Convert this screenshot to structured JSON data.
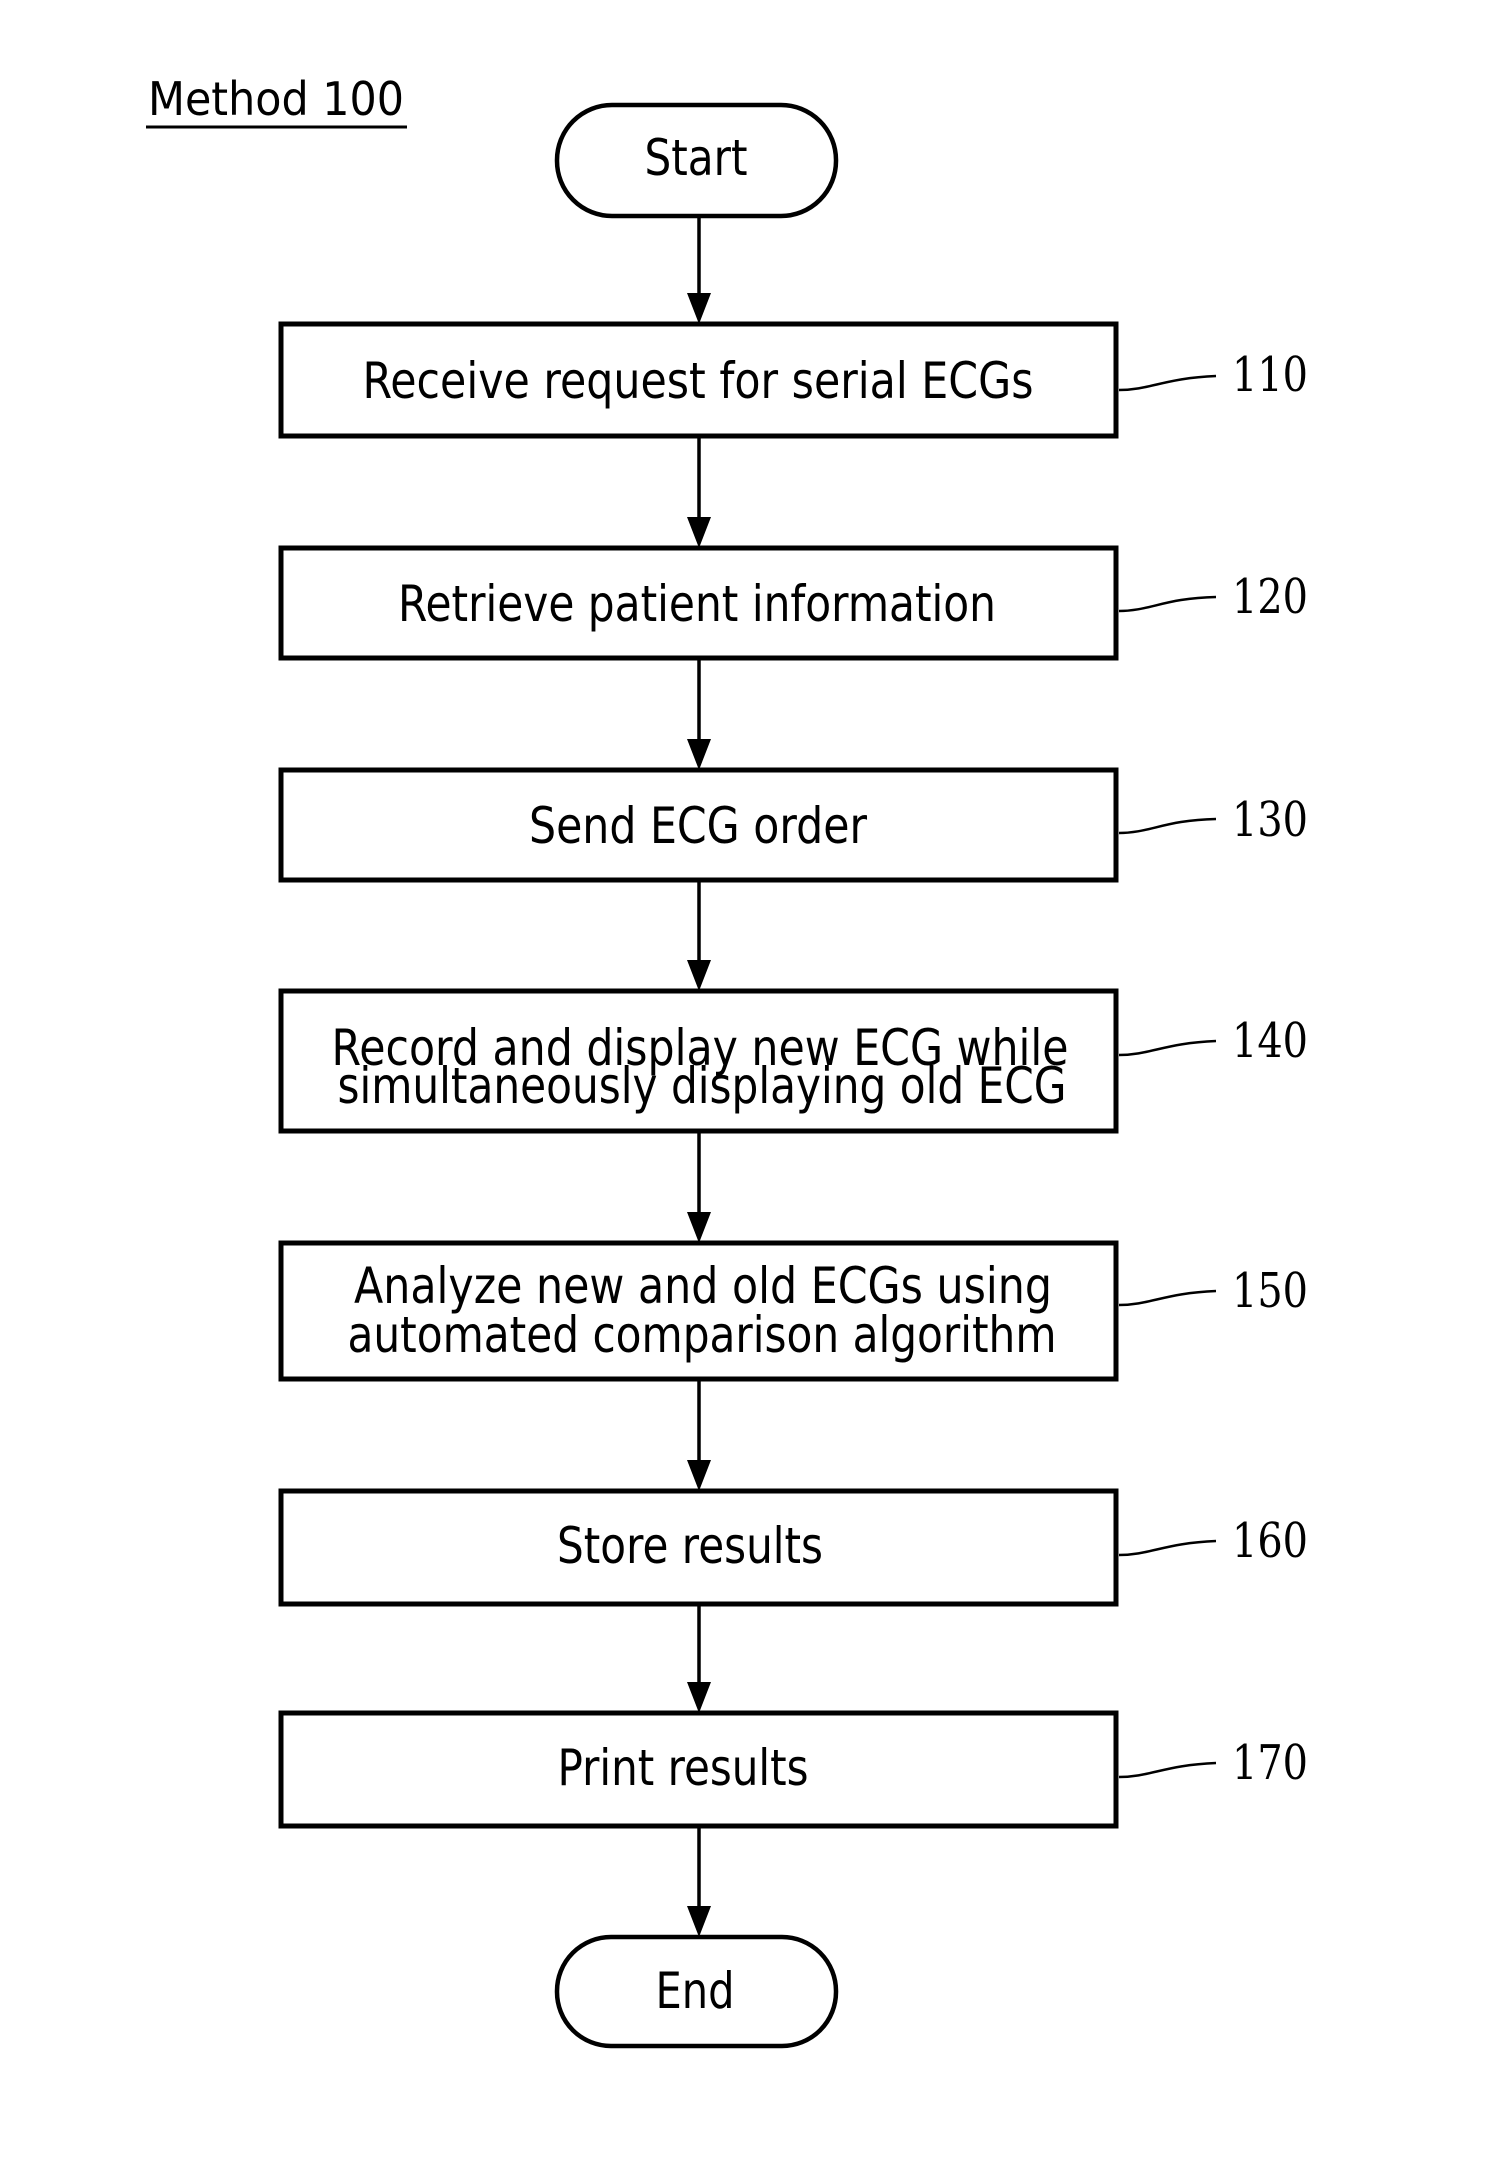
{
  "title": "Method 100",
  "terminals": {
    "start": "Start",
    "end": "End"
  },
  "steps": [
    {
      "ref": "110",
      "lines": [
        "Receive request for serial ECGs"
      ]
    },
    {
      "ref": "120",
      "lines": [
        "Retrieve patient information"
      ]
    },
    {
      "ref": "130",
      "lines": [
        "Send ECG order"
      ]
    },
    {
      "ref": "140",
      "lines": [
        "Record and display new ECG while",
        "simultaneously displaying old ECG"
      ]
    },
    {
      "ref": "150",
      "lines": [
        "Analyze new and old ECGs using",
        "automated comparison algorithm"
      ]
    },
    {
      "ref": "160",
      "lines": [
        "Store results"
      ]
    },
    {
      "ref": "170",
      "lines": [
        "Print results"
      ]
    }
  ],
  "colors": {
    "ink": "#000000",
    "paper": "#ffffff"
  }
}
